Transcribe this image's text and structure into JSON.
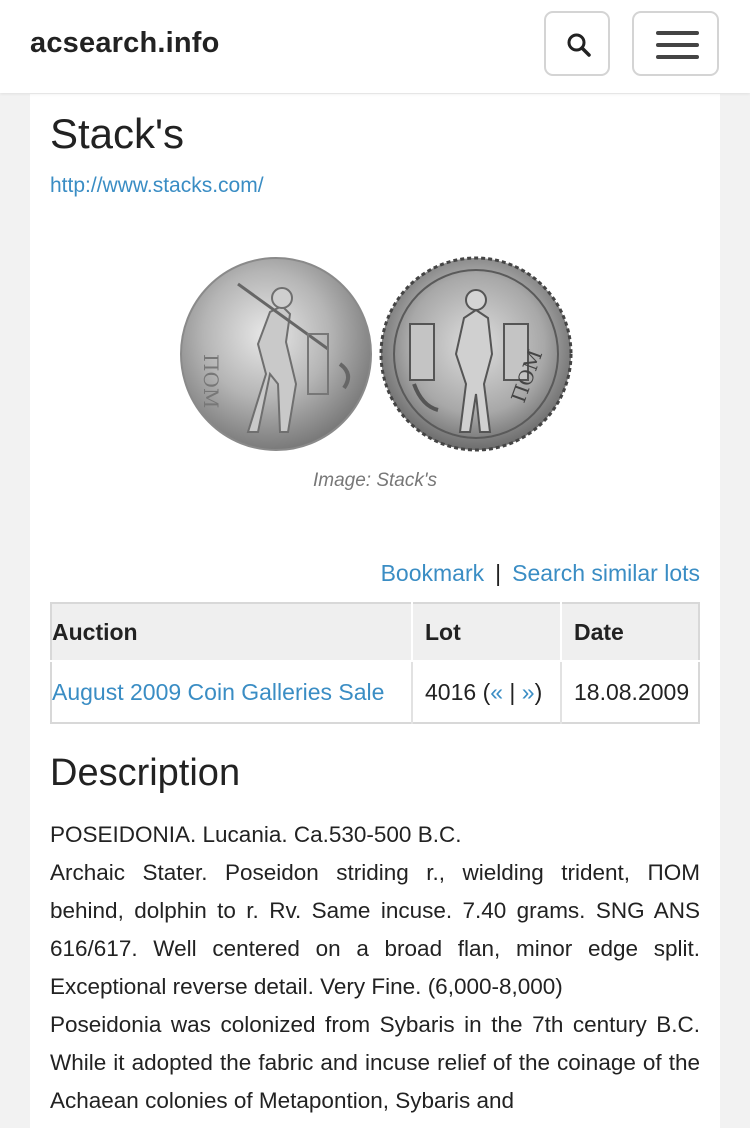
{
  "navbar": {
    "brand": "acsearch.info",
    "search_icon": "search-icon",
    "menu_icon": "hamburger-menu-icon"
  },
  "page": {
    "title": "Stack's",
    "url": "http://www.stacks.com/",
    "image_caption": "Image: Stack's"
  },
  "actions": {
    "bookmark": "Bookmark",
    "separator": "|",
    "search_similar": "Search similar lots"
  },
  "lot_table": {
    "headers": [
      "Auction",
      "Lot",
      "Date"
    ],
    "row": {
      "auction": "August 2009 Coin Galleries Sale",
      "lot_number": "4016",
      "open_paren": "(",
      "prev": "«",
      "pipe": "|",
      "next": "»",
      "close_paren": ")",
      "date": "18.08.2009"
    }
  },
  "description": {
    "heading": "Description",
    "lines": [
      "POSEIDONIA. Lucania. Ca.530-500 B.C.",
      "Archaic Stater. Poseidon striding r., wielding trident, ΠΟΜ behind, dolphin to r. Rv. Same incuse. 7.40 grams. SNG ANS 616/617. Well centered on a broad flan, minor edge split. Exceptional reverse detail. Very Fine. (6,000-8,000)",
      "Poseidonia was colonized from Sybaris in the 7th century B.C. While it adopted the fabric and incuse relief of the coinage of the Achaean colonies of Metapontion, Sybaris and"
    ]
  },
  "colors": {
    "link": "#3a8dc4",
    "background": "#f2f2f2",
    "panel": "#ffffff"
  }
}
